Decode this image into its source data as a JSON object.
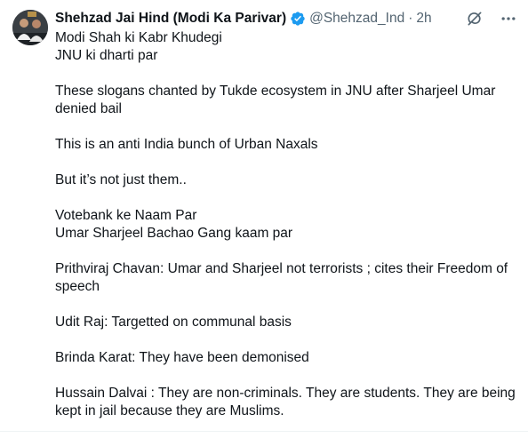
{
  "author": {
    "display_name": "Shehzad Jai Hind (Modi Ka Parivar)",
    "handle": "@Shehzad_Ind",
    "separator": "·",
    "time": "2h"
  },
  "icons": {
    "verified": "verified-badge-icon",
    "grok": "grok-icon",
    "more": "more-options-icon",
    "verified_color": "#1d9bf0"
  },
  "tweet": {
    "paragraphs": [
      [
        "Modi Shah ki Kabr Khudegi",
        "JNU ki dharti par"
      ],
      [
        "These slogans chanted by Tukde ecosystem in JNU after Sharjeel Umar",
        "denied bail"
      ],
      [
        "This is an anti India bunch of Urban Naxals"
      ],
      [
        "But it’s not just them.."
      ],
      [
        "Votebank ke Naam Par",
        "Umar Sharjeel Bachao Gang kaam par"
      ],
      [
        "Prithviraj Chavan: Umar and Sharjeel not terrorists ; cites their Freedom of",
        "speech"
      ],
      [
        "Udit Raj: Targetted on communal basis"
      ],
      [
        "Brinda Karat: They have been demonised"
      ],
      [
        "Hussain Dalvai : They are non-criminals. They are students. They are being",
        "kept in jail because they are Muslims."
      ]
    ]
  }
}
